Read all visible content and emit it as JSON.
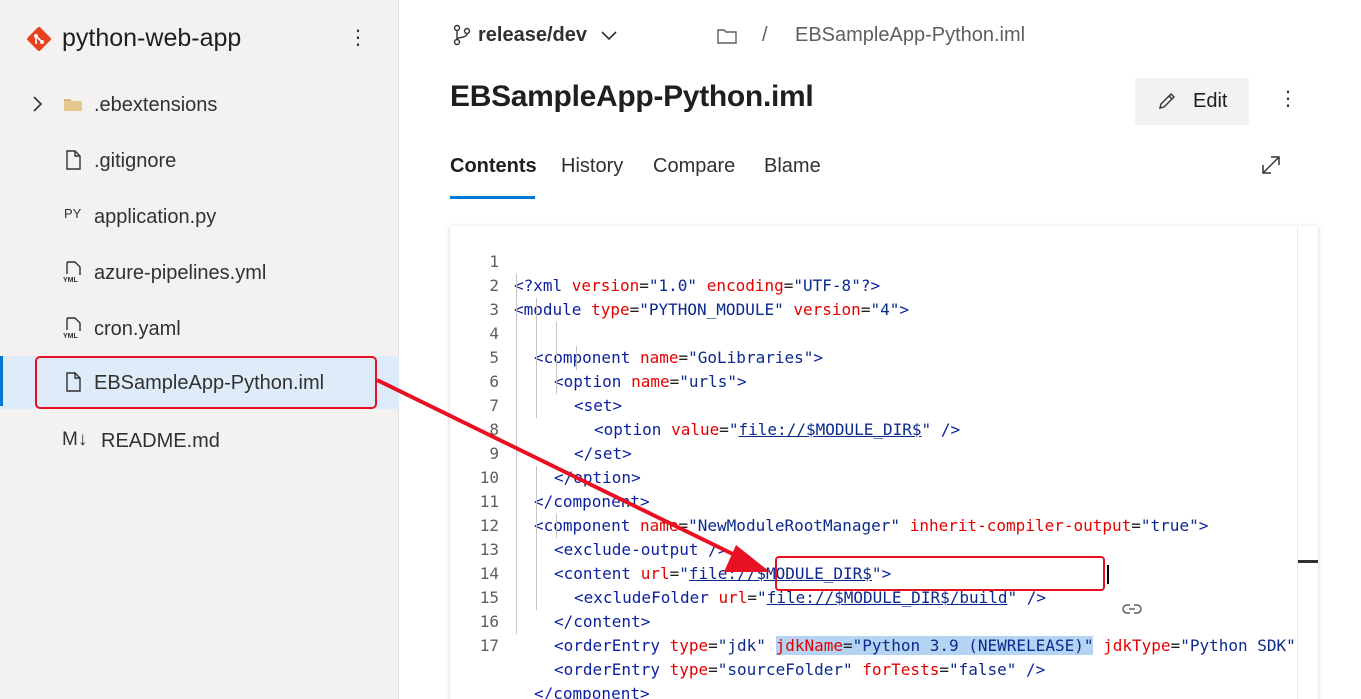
{
  "repo": {
    "name": "python-web-app"
  },
  "sidebar": {
    "items": [
      {
        "label": ".ebextensions",
        "icon": "folder-icon",
        "expandable": true
      },
      {
        "label": ".gitignore",
        "icon": "file-icon"
      },
      {
        "label": "application.py",
        "icon": "python-file-icon",
        "icon_text": "PY"
      },
      {
        "label": "azure-pipelines.yml",
        "icon": "yaml-file-icon",
        "icon_text": "YML"
      },
      {
        "label": "cron.yaml",
        "icon": "yaml-file-icon",
        "icon_text": "YML"
      },
      {
        "label": "EBSampleApp-Python.iml",
        "icon": "file-icon",
        "selected": true
      },
      {
        "label": "README.md",
        "icon": "markdown-file-icon",
        "icon_text": "M↓"
      }
    ]
  },
  "header": {
    "branch": "release/dev",
    "breadcrumb_separator": "/",
    "breadcrumb_file": "EBSampleApp-Python.iml",
    "file_title": "EBSampleApp-Python.iml",
    "edit_label": "Edit"
  },
  "tabs": [
    {
      "label": "Contents",
      "active": true
    },
    {
      "label": "History"
    },
    {
      "label": "Compare"
    },
    {
      "label": "Blame"
    }
  ],
  "colors": {
    "accent": "#0078d4",
    "annotation": "#e81123",
    "selection": "#b5d4f4"
  },
  "code": {
    "line_numbers": [
      "1",
      "2",
      "3",
      "4",
      "5",
      "6",
      "7",
      "8",
      "9",
      "10",
      "11",
      "12",
      "13",
      "14",
      "15",
      "16",
      "17"
    ],
    "l1": {
      "a": "<?xml ",
      "b": "version",
      "c": "=",
      "d": "\"1.0\"",
      "e": " ",
      "f": "encoding",
      "g": "=",
      "h": "\"UTF-8\"",
      "i": "?>"
    },
    "l2": {
      "a": "<module ",
      "b": "type",
      "c": "=",
      "d": "\"PYTHON_MODULE\"",
      "e": " ",
      "f": "version",
      "g": "=",
      "h": "\"4\"",
      "i": ">"
    },
    "l3": {
      "a": "<component ",
      "b": "name",
      "c": "=",
      "d": "\"GoLibraries\"",
      "e": ">"
    },
    "l4": {
      "a": "<option ",
      "b": "name",
      "c": "=",
      "d": "\"urls\"",
      "e": ">"
    },
    "l5": {
      "a": "<set>"
    },
    "l6": {
      "a": "<option ",
      "b": "value",
      "c": "=",
      "d": "\"",
      "e": "file://$MODULE_DIR$",
      "f": "\"",
      "g": " />"
    },
    "l7": {
      "a": "</set>"
    },
    "l8": {
      "a": "</option>"
    },
    "l9": {
      "a": "</component>"
    },
    "l10": {
      "a": "<component ",
      "b": "name",
      "c": "=",
      "d": "\"NewModuleRootManager\"",
      "e": " ",
      "f": "inherit-compiler-output",
      "g": "=",
      "h": "\"true\"",
      "i": ">"
    },
    "l11": {
      "a": "<exclude-output />"
    },
    "l12": {
      "a": "<content ",
      "b": "url",
      "c": "=",
      "d": "\"",
      "e": "file://$MODULE_DIR$",
      "f": "\"",
      "g": ">"
    },
    "l13": {
      "a": "<excludeFolder ",
      "b": "url",
      "c": "=",
      "d": "\"",
      "e": "file://$MODULE_DIR$/build",
      "f": "\"",
      "g": " />"
    },
    "l14": {
      "a": "</content>"
    },
    "l15": {
      "a": "<orderEntry ",
      "b": "type",
      "c": "=",
      "d": "\"jdk\"",
      "e": " ",
      "f": "jdkName",
      "g": "=",
      "h": "\"Python 3.9 (NEWRELEASE)\"",
      "i": " ",
      "j": "jdkType",
      "k": "=",
      "l": "\"Python SDK\""
    },
    "l16": {
      "a": "<orderEntry ",
      "b": "type",
      "c": "=",
      "d": "\"sourceFolder\"",
      "e": " ",
      "f": "forTests",
      "g": "=",
      "h": "\"false\"",
      "i": " />"
    },
    "l17": {
      "a": "</component>"
    }
  }
}
